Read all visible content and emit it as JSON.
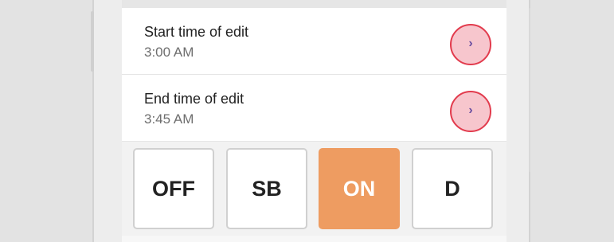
{
  "edit_times": {
    "start": {
      "label": "Start time of edit",
      "value": "3:00 AM",
      "button_icon": "chevron-right-icon"
    },
    "end": {
      "label": "End time of edit",
      "value": "3:45 AM",
      "button_icon": "chevron-right-icon"
    }
  },
  "duty_status": {
    "options": [
      "OFF",
      "SB",
      "ON",
      "D"
    ],
    "selected": "ON"
  },
  "colors": {
    "highlight_ring": "#e23b4d",
    "highlight_fill": "#f7c6cd",
    "active_status": "#ee9c61"
  }
}
